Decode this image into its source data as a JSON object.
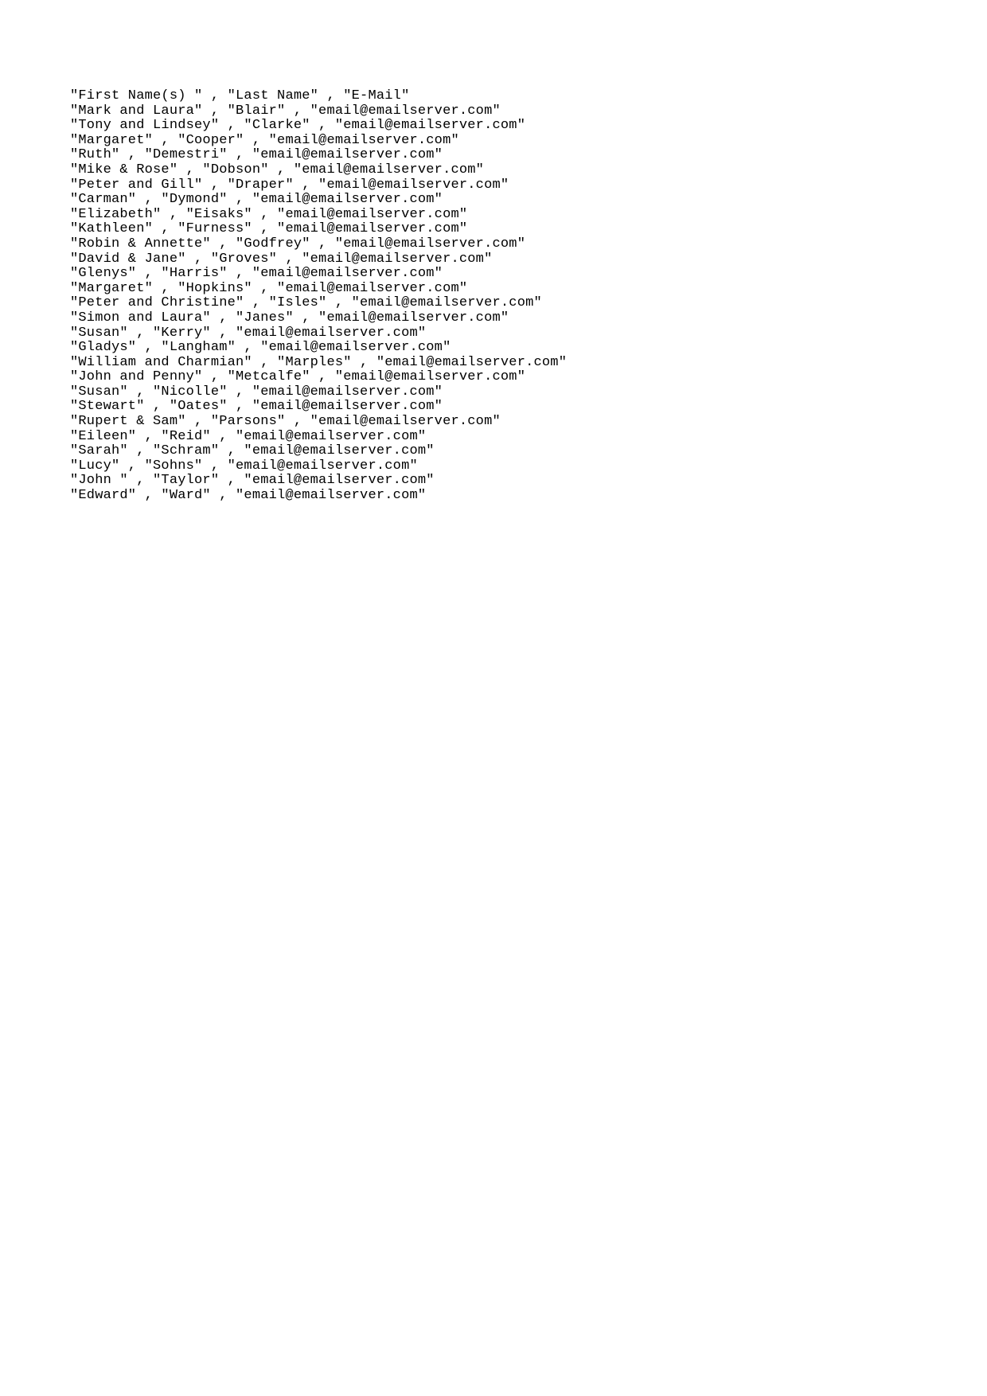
{
  "header": [
    "First Name(s) ",
    "Last Name",
    "E-Mail"
  ],
  "rows": [
    [
      "Mark and Laura",
      "Blair",
      "email@emailserver.com"
    ],
    [
      "Tony and Lindsey",
      "Clarke",
      "email@emailserver.com"
    ],
    [
      "Margaret",
      "Cooper",
      "email@emailserver.com"
    ],
    [
      "Ruth",
      "Demestri",
      "email@emailserver.com"
    ],
    [
      "Mike & Rose",
      "Dobson",
      "email@emailserver.com"
    ],
    [
      "Peter and Gill",
      "Draper",
      "email@emailserver.com"
    ],
    [
      "Carman",
      "Dymond",
      "email@emailserver.com"
    ],
    [
      "Elizabeth",
      "Eisaks",
      "email@emailserver.com"
    ],
    [
      "Kathleen",
      "Furness",
      "email@emailserver.com"
    ],
    [
      "Robin & Annette",
      "Godfrey",
      "email@emailserver.com"
    ],
    [
      "David & Jane",
      "Groves",
      "email@emailserver.com"
    ],
    [
      "Glenys",
      "Harris",
      "email@emailserver.com"
    ],
    [
      "Margaret",
      "Hopkins",
      "email@emailserver.com"
    ],
    [
      "Peter and Christine",
      "Isles",
      "email@emailserver.com"
    ],
    [
      "Simon and Laura",
      "Janes",
      "email@emailserver.com"
    ],
    [
      "Susan",
      "Kerry",
      "email@emailserver.com"
    ],
    [
      "Gladys",
      "Langham",
      "email@emailserver.com"
    ],
    [
      "William and Charmian",
      "Marples",
      "email@emailserver.com"
    ],
    [
      "John and Penny",
      "Metcalfe",
      "email@emailserver.com"
    ],
    [
      "Susan",
      "Nicolle",
      "email@emailserver.com"
    ],
    [
      "Stewart",
      "Oates",
      "email@emailserver.com"
    ],
    [
      "Rupert & Sam",
      "Parsons",
      "email@emailserver.com"
    ],
    [
      "Eileen",
      "Reid",
      "email@emailserver.com"
    ],
    [
      "Sarah",
      "Schram",
      "email@emailserver.com"
    ],
    [
      "Lucy",
      "Sohns",
      "email@emailserver.com"
    ],
    [
      "John ",
      "Taylor",
      "email@emailserver.com"
    ],
    [
      "Edward",
      "Ward",
      "email@emailserver.com"
    ]
  ]
}
